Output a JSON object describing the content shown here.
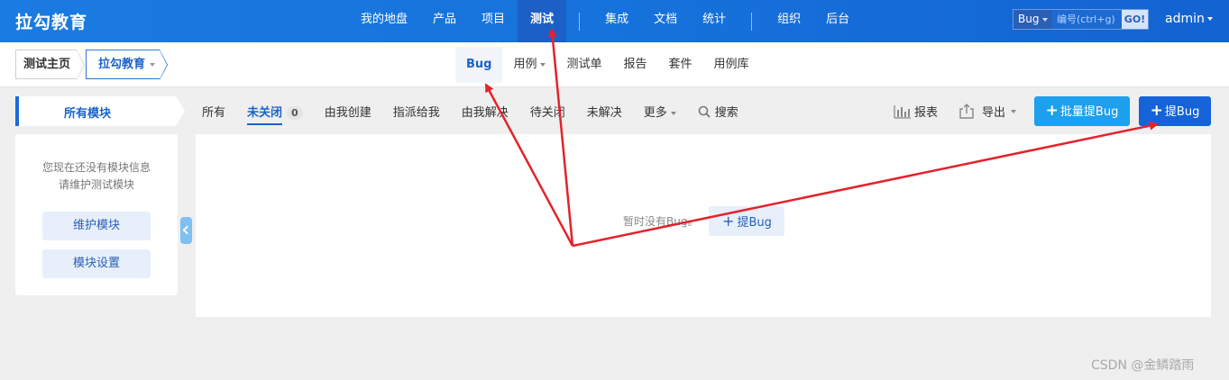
{
  "header": {
    "brand": "拉勾教育",
    "nav": [
      "我的地盘",
      "产品",
      "项目",
      "测试",
      "集成",
      "文档",
      "统计",
      "组织",
      "后台"
    ],
    "active_nav": "测试",
    "search": {
      "type": "Bug",
      "placeholder": "编号(ctrl+g)",
      "go": "GO!"
    },
    "user": "admin"
  },
  "subheader": {
    "breadcrumb": [
      "测试主页",
      "拉勾教育"
    ],
    "tabs": [
      "Bug",
      "用例",
      "测试单",
      "报告",
      "套件",
      "用例库"
    ],
    "active_tab": "Bug"
  },
  "sidebar": {
    "tab_label": "所有模块",
    "empty_line1": "您现在还没有模块信息",
    "empty_line2": "请维护测试模块",
    "maintain_button": "维护模块",
    "settings_button": "模块设置"
  },
  "filters": {
    "all": "所有",
    "unclosed": "未关闭",
    "unclosed_count": "0",
    "created_by_me": "由我创建",
    "assigned_to_me": "指派给我",
    "resolved_by_me": "由我解决",
    "to_close": "待关闭",
    "unresolved": "未解决",
    "more": "更多",
    "search": "搜索"
  },
  "toolbar": {
    "report": "报表",
    "export": "导出",
    "batch_create": "批量提Bug",
    "create": "提Bug"
  },
  "content": {
    "empty_text": "暂时没有Bug。",
    "add_button": "提Bug"
  },
  "watermark": "CSDN @金鳞踏雨",
  "colors": {
    "header_blue": "#1671db",
    "primary": "#1563d8",
    "accent_light": "#1da0ee",
    "annotation_red": "#e3232c"
  }
}
